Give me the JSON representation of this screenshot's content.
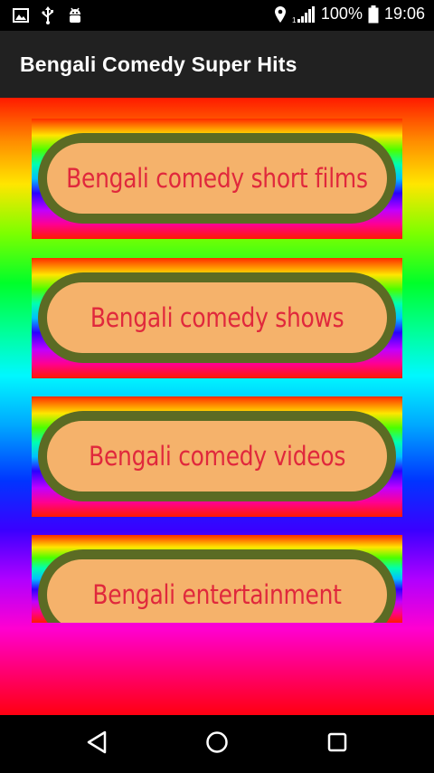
{
  "status_bar": {
    "battery": "100%",
    "time": "19:06"
  },
  "app_bar": {
    "title": "Bengali Comedy Super Hits"
  },
  "menu": {
    "items": [
      {
        "label": "Bengali comedy short films"
      },
      {
        "label": "Bengali comedy shows"
      },
      {
        "label": "Bengali comedy videos"
      },
      {
        "label": "Bengali entertainment"
      }
    ]
  },
  "icons": {
    "status_left": [
      "image-icon",
      "usb-icon",
      "android-debug-icon"
    ],
    "status_right": [
      "location-icon",
      "signal-icon",
      "battery-icon"
    ],
    "nav": [
      "back-icon",
      "home-icon",
      "recents-icon"
    ]
  }
}
